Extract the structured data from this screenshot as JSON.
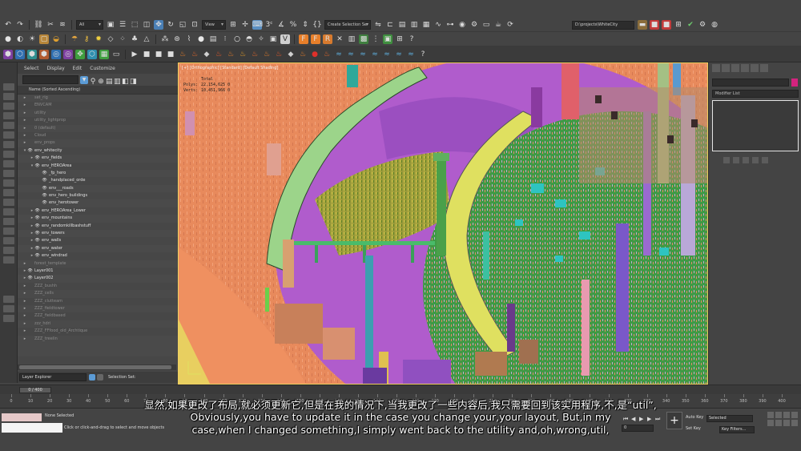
{
  "toolbar": {
    "filter_dropdown": "All",
    "ref_coord_dropdown": "View",
    "selection_set_dropdown": "Create Selection Se",
    "project_path": "D:\\projects\\WhiteCity"
  },
  "explorer": {
    "menu": [
      "Select",
      "Display",
      "Edit",
      "Customize"
    ],
    "column_header": "Name (Sorted Ascending)",
    "rows": [
      {
        "label": "set_rig",
        "depth": 1,
        "hidden": true,
        "twisty": "▸"
      },
      {
        "label": "ENVCAM",
        "depth": 1,
        "hidden": true,
        "twisty": "▸"
      },
      {
        "label": "utility",
        "depth": 1,
        "hidden": true,
        "twisty": "▸"
      },
      {
        "label": "utility_lightprop",
        "depth": 1,
        "hidden": true,
        "twisty": "▸"
      },
      {
        "label": "0 (default)",
        "depth": 1,
        "hidden": true,
        "twisty": "▸"
      },
      {
        "label": "Cloud",
        "depth": 1,
        "hidden": true,
        "twisty": "▸"
      },
      {
        "label": "env_props",
        "depth": 1,
        "hidden": true,
        "twisty": "▸"
      },
      {
        "label": "env_whitecity",
        "depth": 1,
        "hidden": false,
        "twisty": "▾"
      },
      {
        "label": "env_fields",
        "depth": 2,
        "hidden": false,
        "twisty": "▸"
      },
      {
        "label": "env_HEROArea",
        "depth": 2,
        "hidden": false,
        "twisty": "▾"
      },
      {
        "label": "_fp_hero",
        "depth": 3,
        "hidden": false,
        "twisty": ""
      },
      {
        "label": "_handplaced_orde",
        "depth": 3,
        "hidden": false,
        "twisty": ""
      },
      {
        "label": "env___roads",
        "depth": 3,
        "hidden": false,
        "twisty": ""
      },
      {
        "label": "env_hero_buildings",
        "depth": 3,
        "hidden": false,
        "twisty": ""
      },
      {
        "label": "env_herotower",
        "depth": 3,
        "hidden": false,
        "twisty": ""
      },
      {
        "label": "env_HEROArea_Lower",
        "depth": 2,
        "hidden": false,
        "twisty": "▸"
      },
      {
        "label": "env_mountains",
        "depth": 2,
        "hidden": false,
        "twisty": "▸"
      },
      {
        "label": "env_randomkillbashstuff",
        "depth": 2,
        "hidden": false,
        "twisty": "▸"
      },
      {
        "label": "env_towers",
        "depth": 2,
        "hidden": false,
        "twisty": "▸"
      },
      {
        "label": "env_walls",
        "depth": 2,
        "hidden": false,
        "twisty": "▸"
      },
      {
        "label": "env_water",
        "depth": 2,
        "hidden": false,
        "twisty": "▸"
      },
      {
        "label": "env_windrad",
        "depth": 2,
        "hidden": false,
        "twisty": "▸"
      },
      {
        "label": "forest_template",
        "depth": 1,
        "hidden": true,
        "twisty": "▸"
      },
      {
        "label": "Layer001",
        "depth": 1,
        "hidden": false,
        "twisty": "▸"
      },
      {
        "label": "Layer002",
        "depth": 1,
        "hidden": false,
        "twisty": "▸"
      },
      {
        "label": "ZZZ_bushh",
        "depth": 1,
        "hidden": true,
        "twisty": "▸"
      },
      {
        "label": "ZZZ_cells",
        "depth": 1,
        "hidden": true,
        "twisty": "▸"
      },
      {
        "label": "ZZZ_clutteam",
        "depth": 1,
        "hidden": true,
        "twisty": "▸"
      },
      {
        "label": "ZZZ_fieldtower",
        "depth": 1,
        "hidden": true,
        "twisty": "▸"
      },
      {
        "label": "ZZZ_fieldbased",
        "depth": 1,
        "hidden": true,
        "twisty": "▸"
      },
      {
        "label": "zzz_hdri",
        "depth": 1,
        "hidden": true,
        "twisty": "▸"
      },
      {
        "label": "ZZZ_FFfood_old_Archtique",
        "depth": 1,
        "hidden": true,
        "twisty": "▸"
      },
      {
        "label": "ZZZ_treelin",
        "depth": 1,
        "hidden": true,
        "twisty": "▸"
      }
    ],
    "layer_explorer": "Layer Explorer",
    "selection_set": "Selection Set:"
  },
  "viewport": {
    "label": "[+] [Orthographic] [Standard] [Default Shading]",
    "stats": [
      {
        "k": "",
        "v": "Total"
      },
      {
        "k": "Polys:",
        "v": "22,154,625   0"
      },
      {
        "k": "Verts:",
        "v": "10,451,966   0"
      }
    ]
  },
  "command_panel": {
    "modifier_list": "Modifier List"
  },
  "timeline": {
    "slider": "0 / 400",
    "ticks": [
      0,
      10,
      20,
      30,
      40,
      50,
      60,
      70,
      80,
      90,
      100,
      110,
      120,
      130,
      140,
      150,
      160,
      170,
      180,
      190,
      200,
      210,
      220,
      230,
      240,
      250,
      260,
      270,
      280,
      290,
      300,
      310,
      320,
      330,
      340,
      350,
      360,
      370,
      380,
      390,
      400
    ]
  },
  "status": {
    "selected": "None Selected",
    "prompt": "Click or click-and-drag to select and move objects",
    "auto_key": "Auto Key",
    "set_key": "Set Key",
    "selected_dd": "Selected",
    "key_filters": "Key Filters...",
    "frame": "0"
  },
  "subtitles": {
    "zh": "显然,如果更改了布局,就必须更新它,但是在我的情况下,当我更改了一些内容后,我只需要回到该实用程序,不,是“util”,",
    "en1": "Obviously,you have to update it in the case you change your,your layout, But,in my",
    "en2": "case,when I changed something,I simply went back to the utility and,oh,wrong,util,"
  },
  "colors": {
    "panel": "#444444",
    "viewport_border": "#f0d060",
    "accent": "#5b9bd5"
  }
}
